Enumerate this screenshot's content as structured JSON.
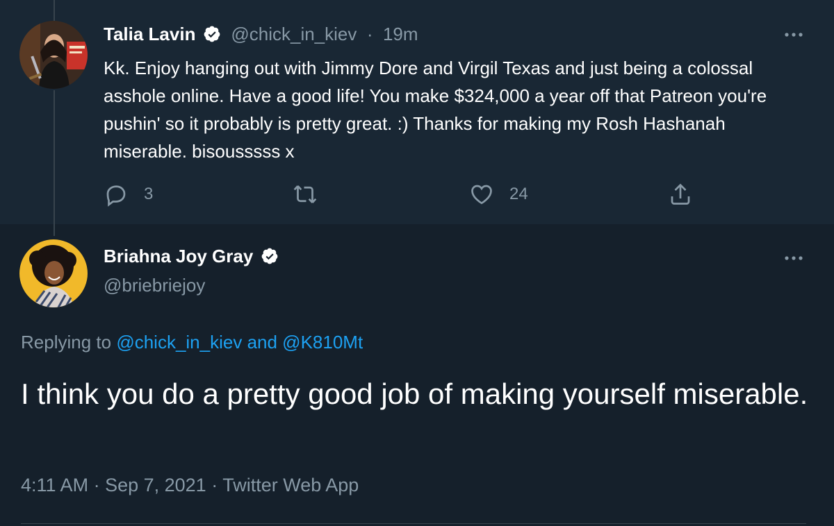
{
  "parent_tweet": {
    "name": "Talia Lavin",
    "handle": "@chick_in_kiev",
    "separator": "·",
    "time": "19m",
    "text": "Kk. Enjoy hanging out with Jimmy Dore and Virgil Texas and just being a colossal asshole online. Have a good life! You make $324,000 a year off that Patreon you're pushin' so it probably is pretty great. :) Thanks for making my Rosh Hashanah miserable. bisousssss x",
    "reply_count": "3",
    "retweet_count": "",
    "like_count": "24"
  },
  "main_tweet": {
    "name": "Briahna Joy Gray",
    "handle": "@briebriejoy",
    "replying_prefix": "Replying to ",
    "replying_user1": "@chick_in_kiev",
    "replying_and": " and ",
    "replying_user2": "@K810Mt",
    "text": "I think you do a pretty good job of making yourself miserable.",
    "time": "4:11 AM",
    "sep1": " · ",
    "date": "Sep 7, 2021",
    "sep2": " · ",
    "source": "Twitter Web App"
  },
  "colors": {
    "background": "#15202b",
    "parent_background": "#192734",
    "muted_text": "#8899a6",
    "link": "#1da1f2",
    "verified_badge": "#ffffff"
  },
  "icons": [
    "verified-badge-icon",
    "more-icon",
    "reply-icon",
    "retweet-icon",
    "like-icon",
    "share-icon"
  ]
}
